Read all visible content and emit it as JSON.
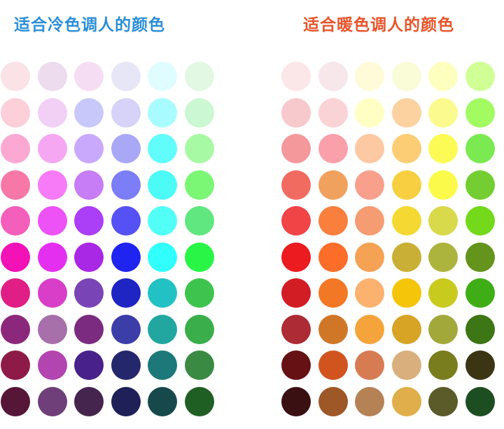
{
  "titles": {
    "cool": "适合冷色调人的颜色",
    "warm": "适合暖色调人的颜色"
  },
  "title_colors": {
    "cool": "#2b8fd8",
    "warm": "#e8542a"
  },
  "cool_palette": [
    [
      "#fbe2e6",
      "#ecdcee",
      "#f5ddf3",
      "#e7e6f6",
      "#dffdff",
      "#e2f8e2"
    ],
    [
      "#fccfd9",
      "#f2d0f6",
      "#c8c8fa",
      "#d6d2f8",
      "#a8fcff",
      "#cbf7d3"
    ],
    [
      "#fba8d3",
      "#f5a8f1",
      "#c9a9fb",
      "#a8a8f7",
      "#61fdfa",
      "#a8f9a4"
    ],
    [
      "#f777a6",
      "#f77bf7",
      "#c77df5",
      "#7b7ef7",
      "#4cfbf5",
      "#7bf775"
    ],
    [
      "#f35fbb",
      "#ed52f6",
      "#ab3ef7",
      "#5551f4",
      "#52fff6",
      "#60e77f"
    ],
    [
      "#f212b5",
      "#e52ff0",
      "#a928e6",
      "#1f24f0",
      "#30fffd",
      "#29f547"
    ],
    [
      "#e11e85",
      "#d93ec9",
      "#7944b5",
      "#1e25c3",
      "#22c2c4",
      "#3ec44e"
    ],
    [
      "#8c287b",
      "#a870ab",
      "#7b2b80",
      "#3b3ea9",
      "#21a6a0",
      "#39ae4b"
    ],
    [
      "#8e1b47",
      "#b345b1",
      "#48228a",
      "#25276d",
      "#1d7979",
      "#3a8a44"
    ],
    [
      "#551638",
      "#6f3f79",
      "#45244e",
      "#1e2057",
      "#17494c",
      "#1f5f24"
    ]
  ],
  "warm_palette": [
    [
      "#fbe6e8",
      "#f7e7ea",
      "#fffbd9",
      "#fafcd8",
      "#fdffbe",
      "#cfff95"
    ],
    [
      "#f7c8cc",
      "#fad3d7",
      "#ffffc4",
      "#fcd2a1",
      "#fbfa8e",
      "#a1fb61"
    ],
    [
      "#f4989c",
      "#f9a0aa",
      "#fcc9a2",
      "#fccd74",
      "#fcfb55",
      "#7be951"
    ],
    [
      "#f26b61",
      "#f0a15e",
      "#f8a08c",
      "#f7cf41",
      "#fbfa4a",
      "#74ce31"
    ],
    [
      "#f04447",
      "#fa7f3c",
      "#f59c72",
      "#f5d932",
      "#d9d94c",
      "#73d91a"
    ],
    [
      "#ec1b1f",
      "#fb6d28",
      "#f6a254",
      "#c9af35",
      "#acb43e",
      "#64941c"
    ],
    [
      "#d21d25",
      "#f37825",
      "#fbb26e",
      "#f5c50a",
      "#c8cb1e",
      "#3fad16"
    ],
    [
      "#ac2b35",
      "#d07727",
      "#f4a43a",
      "#d7a426",
      "#a3a83b",
      "#3d7614"
    ],
    [
      "#661113",
      "#d1541f",
      "#d77b53",
      "#d9b07d",
      "#7a7d1e",
      "#3b3514"
    ],
    [
      "#3a1013",
      "#9e5727",
      "#b58256",
      "#e0af4b",
      "#5b5a29",
      "#1c4e22"
    ]
  ]
}
